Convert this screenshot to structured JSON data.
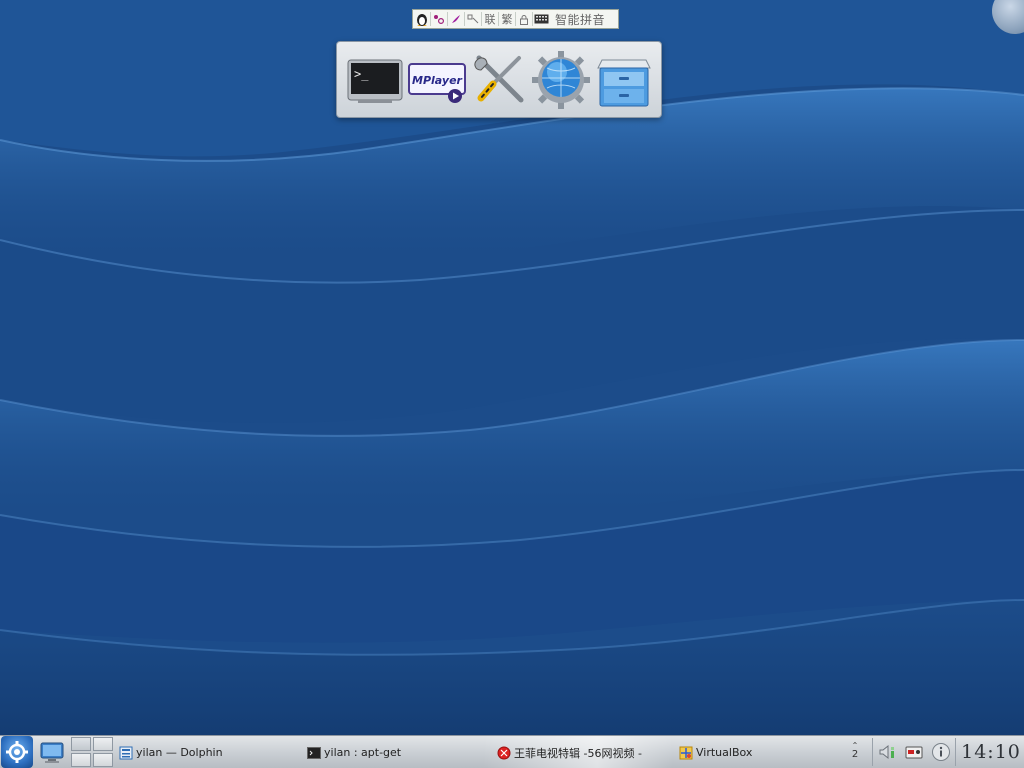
{
  "ime": {
    "icons": [
      "penguin-icon",
      "punctuation-icon",
      "brush-icon",
      "handwriting-icon"
    ],
    "lian": "联",
    "fan": "繁",
    "mode": "智能拼音"
  },
  "launcher": {
    "items": [
      {
        "name": "terminal-icon",
        "label": ">_"
      },
      {
        "name": "mplayer-icon",
        "label": "MPlayer"
      },
      {
        "name": "settings-tools-icon"
      },
      {
        "name": "browser-globe-icon"
      },
      {
        "name": "file-manager-icon"
      }
    ]
  },
  "taskbar": {
    "tasks": [
      {
        "title": "yilan — Dolphin",
        "icon": "dolphin-icon"
      },
      {
        "title": "yilan : apt-get",
        "icon": "terminal-icon"
      },
      {
        "title": "王菲电视特辑 -56网视频 -",
        "icon": "browser-icon"
      },
      {
        "title": "VirtualBox",
        "icon": "virtualbox-icon"
      }
    ],
    "desktop_number": "2",
    "clock": "14:10"
  },
  "colors": {
    "wallpaper": "#1d4f8e",
    "taskbar": "#c9ced3",
    "accent": "#2d6fc0"
  }
}
